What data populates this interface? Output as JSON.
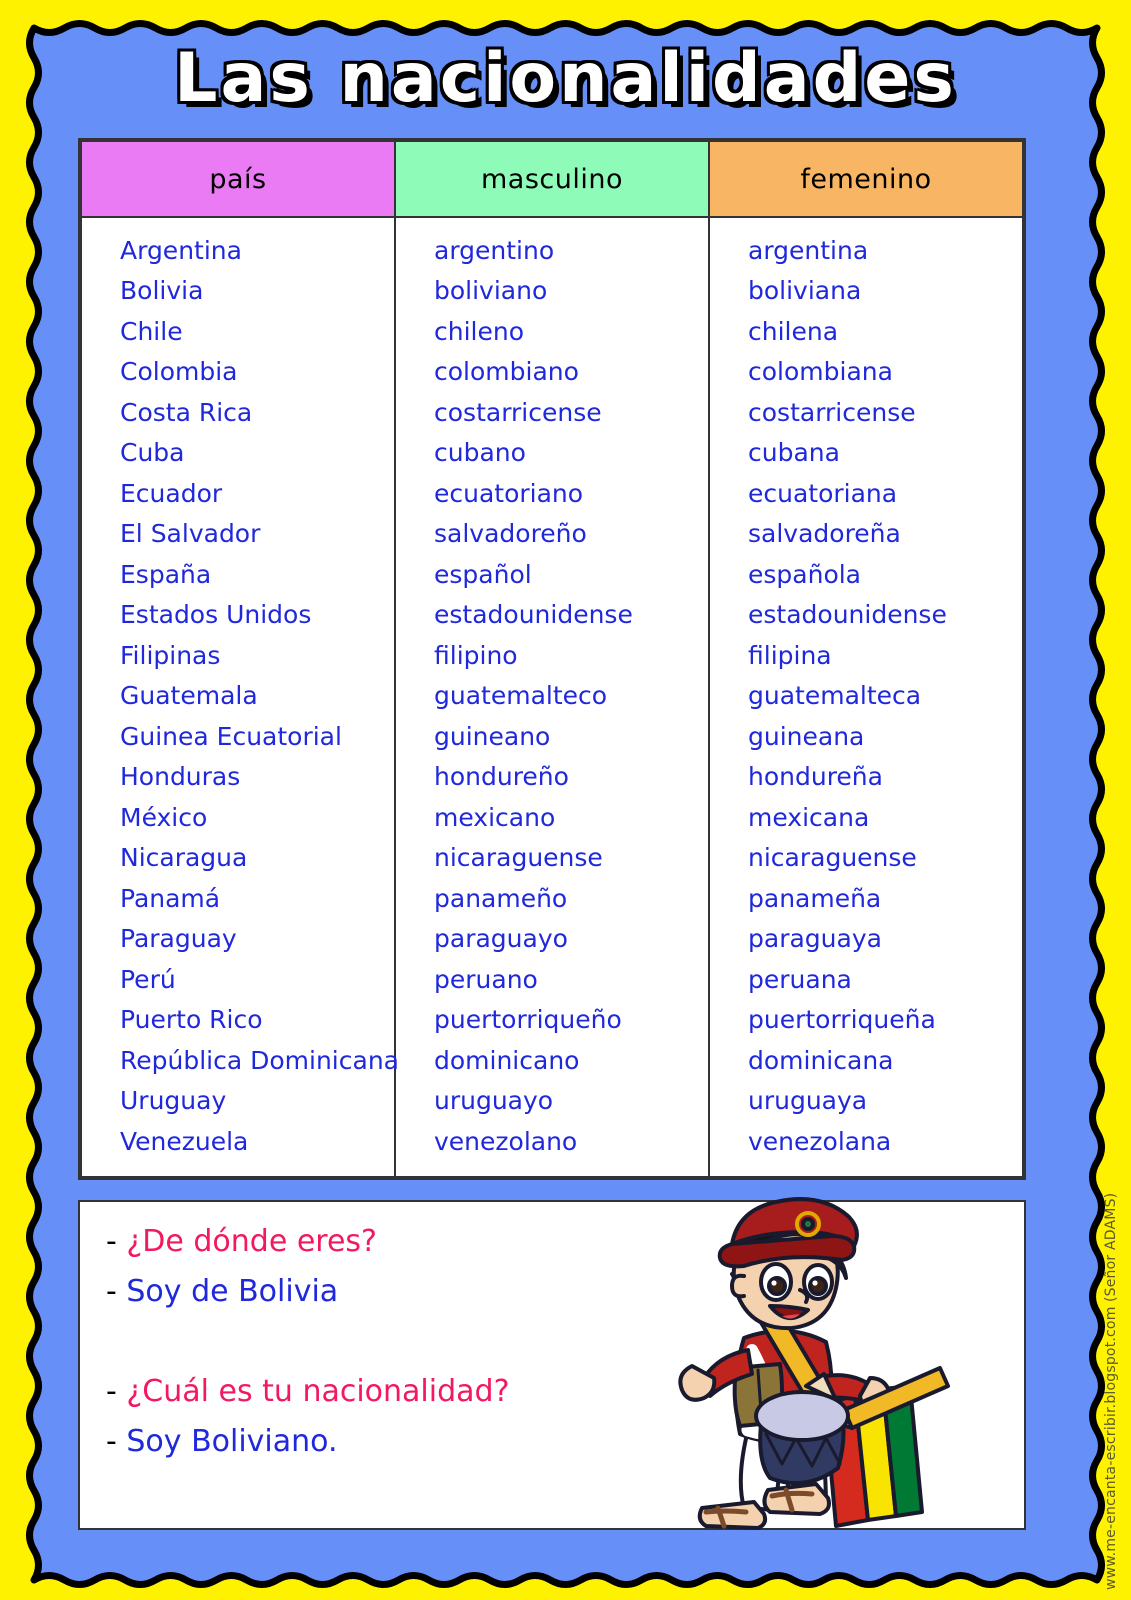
{
  "page": {
    "title": "Las nacionalidades",
    "background_color": "#FFF200",
    "panel_color": "#6690F7"
  },
  "table": {
    "headers": [
      {
        "label": "país",
        "color": "#EB7BF4"
      },
      {
        "label": "masculino",
        "color": "#8FFBB8"
      },
      {
        "label": "femenino",
        "color": "#F8B664"
      }
    ],
    "text_color": "#2028DC",
    "rows": [
      {
        "pais": "Argentina",
        "masculino": "argentino",
        "femenino": "argentina"
      },
      {
        "pais": "Bolivia",
        "masculino": "boliviano",
        "femenino": "boliviana"
      },
      {
        "pais": "Chile",
        "masculino": "chileno",
        "femenino": "chilena"
      },
      {
        "pais": "Colombia",
        "masculino": "colombiano",
        "femenino": "colombiana"
      },
      {
        "pais": "Costa Rica",
        "masculino": "costarricense",
        "femenino": "costarricense"
      },
      {
        "pais": "Cuba",
        "masculino": "cubano",
        "femenino": "cubana"
      },
      {
        "pais": "Ecuador",
        "masculino": "ecuatoriano",
        "femenino": "ecuatoriana"
      },
      {
        "pais": "El Salvador",
        "masculino": "salvadoreño",
        "femenino": "salvadoreña"
      },
      {
        "pais": "España",
        "masculino": "español",
        "femenino": "española"
      },
      {
        "pais": "Estados Unidos",
        "masculino": "estadounidense",
        "femenino": "estadounidense"
      },
      {
        "pais": "Filipinas",
        "masculino": "filipino",
        "femenino": "filipina"
      },
      {
        "pais": "Guatemala",
        "masculino": "guatemalteco",
        "femenino": "guatemalteca"
      },
      {
        "pais": "Guinea Ecuatorial",
        "masculino": "guineano",
        "femenino": "guineana"
      },
      {
        "pais": "Honduras",
        "masculino": "hondureño",
        "femenino": "hondureña"
      },
      {
        "pais": "México",
        "masculino": "mexicano",
        "femenino": "mexicana"
      },
      {
        "pais": "Nicaragua",
        "masculino": "nicaraguense",
        "femenino": "nicaraguense"
      },
      {
        "pais": "Panamá",
        "masculino": "panameño",
        "femenino": "panameña"
      },
      {
        "pais": "Paraguay",
        "masculino": "paraguayo",
        "femenino": "paraguaya"
      },
      {
        "pais": "Perú",
        "masculino": "peruano",
        "femenino": "peruana"
      },
      {
        "pais": "Puerto Rico",
        "masculino": "puertorriqueño",
        "femenino": "puertorriqueña"
      },
      {
        "pais": "República Dominicana",
        "masculino": "dominicano",
        "femenino": "dominicana"
      },
      {
        "pais": "Uruguay",
        "masculino": "uruguayo",
        "femenino": "uruguaya"
      },
      {
        "pais": "Venezuela",
        "masculino": "venezolano",
        "femenino": "venezolana"
      }
    ]
  },
  "dialog": {
    "question_color": "#F2195F",
    "answer_color": "#2028DC",
    "dash": "-",
    "lines": [
      {
        "type": "question",
        "text": "¿De dónde eres?"
      },
      {
        "type": "answer",
        "text": "Soy de Bolivia"
      },
      {
        "type": "question",
        "text": "¿Cuál es tu nacionalidad?"
      },
      {
        "type": "answer",
        "text": "Soy Boliviano."
      }
    ]
  },
  "credit": {
    "website": "www.me-encanta-escribir.blogspot.com",
    "author": "(Señor ADAMS)"
  },
  "illustration": {
    "name": "boy-drummer-bolivia-icon",
    "description": "Cartoon boy with red cap playing a drum with pencils, holding a Bolivian flag"
  }
}
